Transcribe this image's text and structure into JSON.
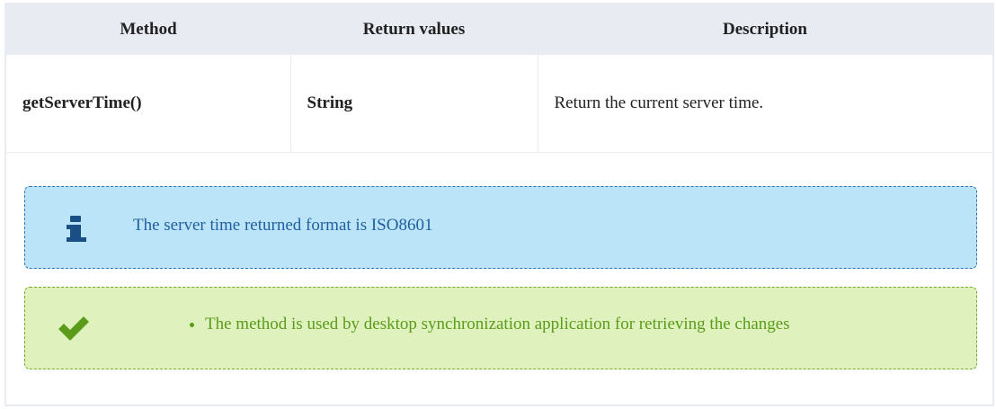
{
  "table": {
    "headers": [
      "Method",
      "Return values",
      "Description"
    ],
    "rows": [
      {
        "method": "getServerTime()",
        "return_value": "String",
        "description": "Return the current server time."
      }
    ]
  },
  "notes": {
    "info": {
      "icon": "info-icon",
      "text": "The server time returned format is ISO8601",
      "color": "#1f5f9e",
      "background": "#bce4f8"
    },
    "success": {
      "icon": "checkmark-icon",
      "items": [
        "The method is used by desktop synchronization application for retrieving the changes"
      ],
      "color": "#5a9b1a",
      "background": "#dff2be"
    }
  }
}
